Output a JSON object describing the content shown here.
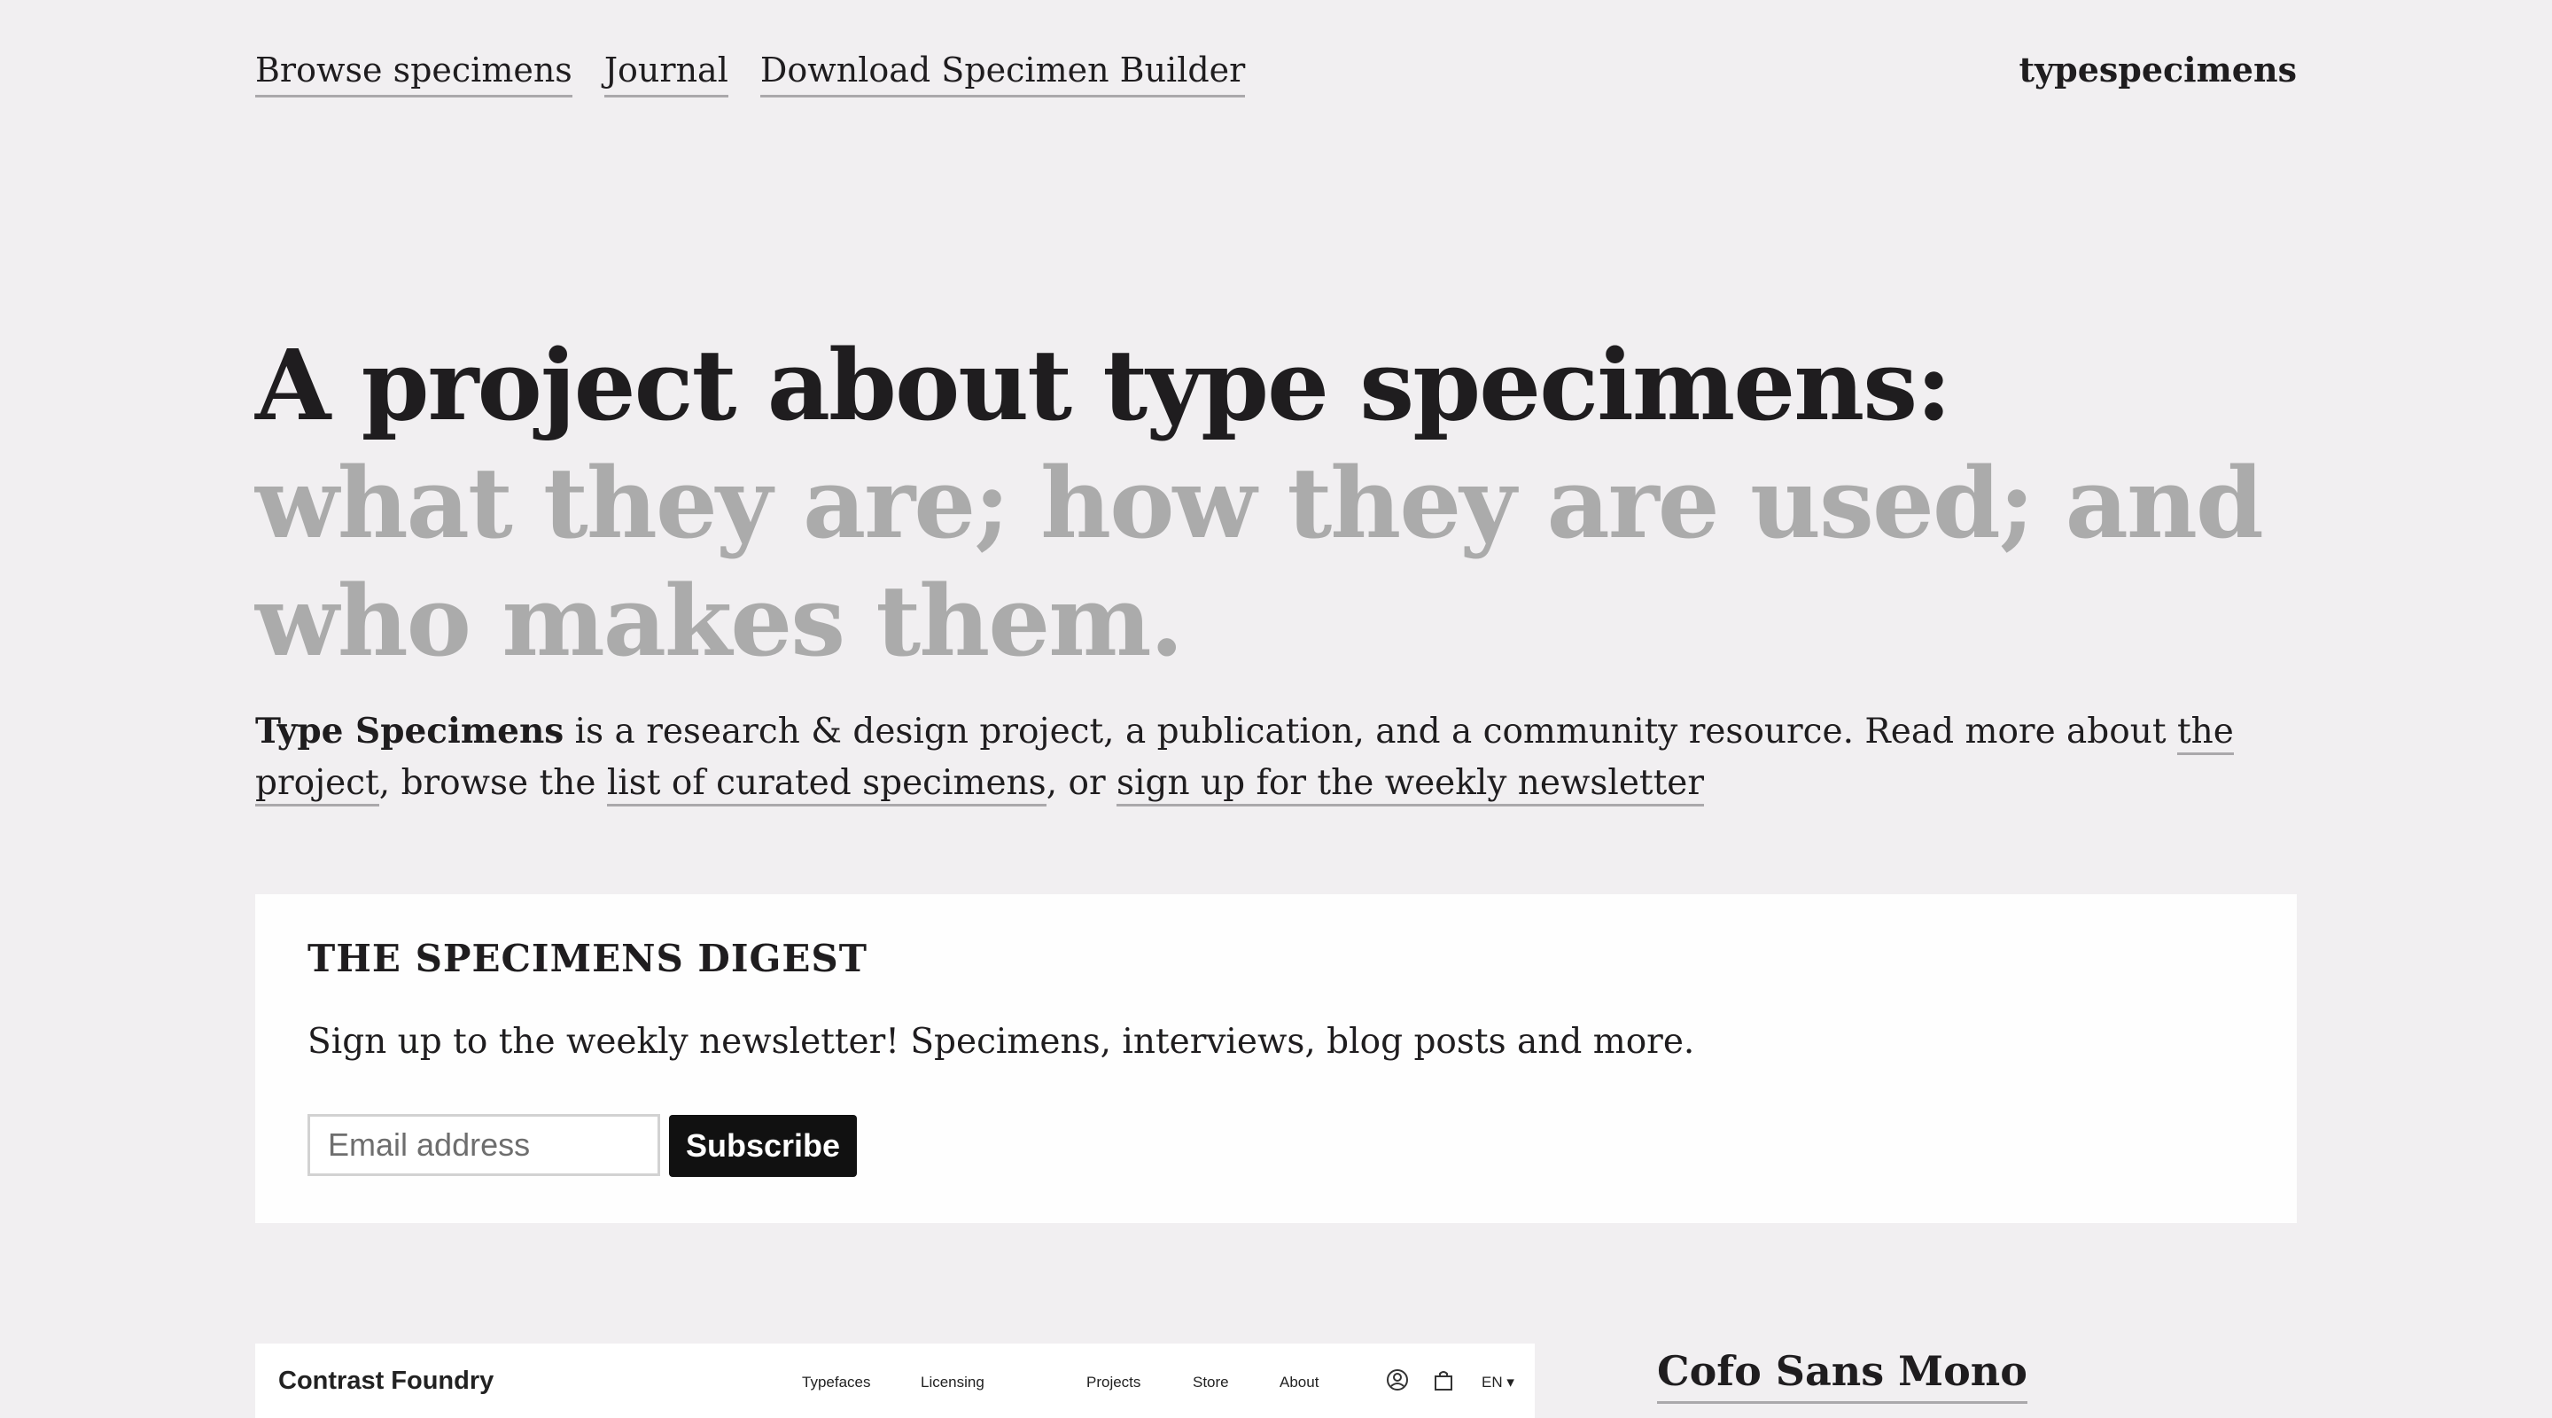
{
  "nav": {
    "items": [
      "Browse specimens",
      "Journal",
      "Download Specimen Builder"
    ],
    "brand": "typespecimens"
  },
  "hero": {
    "line1": "A project about type specimens:",
    "line2": "what they are; how they are used; and who makes them."
  },
  "intro": {
    "bold": "Type Specimens",
    "text1": " is a research & design project, a publication, and a community resource. Read more about ",
    "link1": "the project",
    "text2": ", browse the ",
    "link2": "list of curated specimens",
    "text3": ", or ",
    "link3": "sign up for the weekly newsletter"
  },
  "digest": {
    "title": "THE SPECIMENS DIGEST",
    "description": "Sign up to the weekly newsletter! Specimens, interviews, blog posts and more.",
    "email_placeholder": "Email address",
    "subscribe_label": "Subscribe"
  },
  "preview": {
    "logo": "Contrast Foundry",
    "nav": [
      "Typefaces",
      "Licensing",
      "Projects",
      "Store",
      "About"
    ],
    "lang": "EN",
    "icons": [
      "user-icon",
      "bag-icon"
    ]
  },
  "featured": {
    "title": "Cofo Sans Mono"
  }
}
